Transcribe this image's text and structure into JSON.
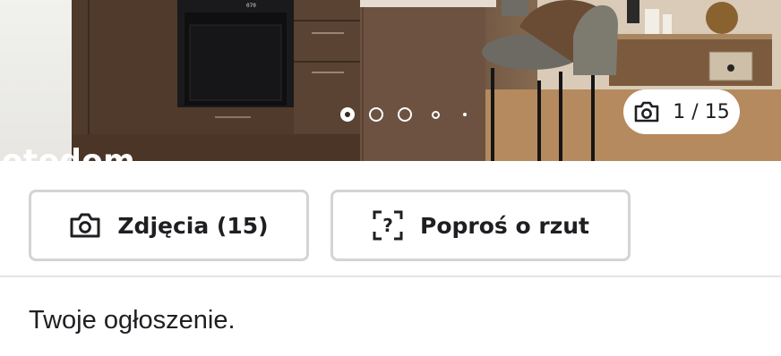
{
  "gallery": {
    "prev_slide_text": "otodom",
    "dots": [
      {
        "state": "active"
      },
      {
        "state": "inactive"
      },
      {
        "state": "inactive"
      },
      {
        "state": "small"
      },
      {
        "state": "tiny"
      }
    ],
    "counter_text": "1 / 15",
    "oven_display": "070"
  },
  "actions": {
    "photos_label": "Zdjęcia (15)",
    "floorplan_label": "Poproś o rzut"
  },
  "note": {
    "text": "Twoje ogłoszenie."
  },
  "colors": {
    "text": "#1f1f23",
    "button_border": "#d4d4d8",
    "divider": "#e4e4e7"
  }
}
